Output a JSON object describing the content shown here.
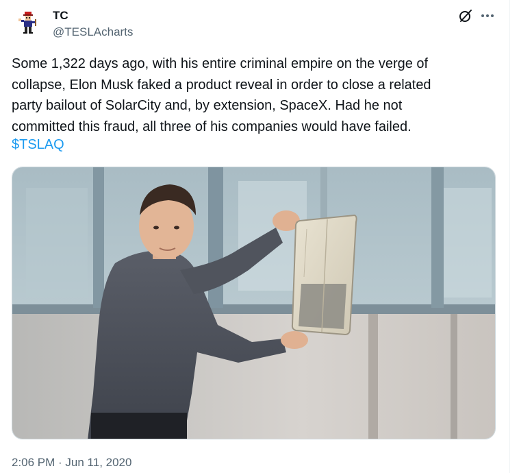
{
  "tweet": {
    "author": {
      "name": "TC",
      "handle": "@TESLAcharts"
    },
    "text": "Some 1,322 days ago, with his entire criminal empire on the verge of\ncollapse, Elon Musk faked a product reveal in order to close a related\nparty bailout of SolarCity and, by extension, SpaceX. Had he not\ncommitted this fraud, all three of his companies would have failed.",
    "cashtag": "$TSLAQ",
    "timestamp": "2:06 PM · Jun 11, 2020",
    "icons": {
      "grok": "grok-slash-circle-icon",
      "more": "more-horizontal-icon"
    },
    "colors": {
      "link": "#1d9bf0",
      "secondary_text": "#536471",
      "primary_text": "#0f1419"
    }
  }
}
